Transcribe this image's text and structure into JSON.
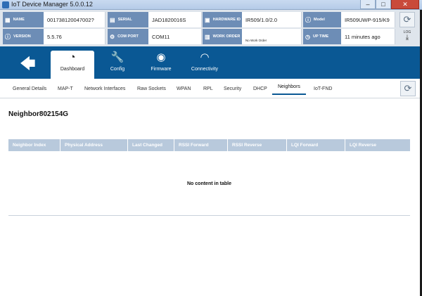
{
  "window": {
    "title": "IoT Device Manager 5.0.0.12",
    "minimize": "–",
    "maximize": "□",
    "close": "✕"
  },
  "info": {
    "row1": [
      {
        "label": "NAME",
        "value": "001738120047002?",
        "icon": "tag-icon"
      },
      {
        "label": "SERIAL",
        "value": "JAD1820016S",
        "icon": "barcode-icon"
      },
      {
        "label": "HARDWARE ID",
        "value": "IR509/1.0/2.0",
        "icon": "chip-icon"
      },
      {
        "label": "Model",
        "value": "IR509UWP-915/K9",
        "icon": "info-icon"
      }
    ],
    "row2": [
      {
        "label": "VERSION",
        "value": "5.5.76",
        "icon": "info-icon"
      },
      {
        "label": "COM PORT",
        "value": "COM11",
        "icon": "port-icon"
      },
      {
        "label": "WORK ORDER",
        "value": "No Work Order",
        "icon": "clipboard-icon"
      },
      {
        "label": "UP TIME",
        "value": "11 minutes ago",
        "icon": "clock-icon"
      }
    ],
    "log_label": "LOG"
  },
  "nav": {
    "items": [
      {
        "label": "Dashboard",
        "icon": "gauge-icon",
        "active": true
      },
      {
        "label": "Config",
        "icon": "wrench-icon"
      },
      {
        "label": "Firmware",
        "icon": "disc-icon"
      },
      {
        "label": "Connectivity",
        "icon": "wifi-icon"
      }
    ]
  },
  "subtabs": [
    "General Details",
    "MAP-T",
    "Network Interfaces",
    "Raw Sockets",
    "WPAN",
    "RPL",
    "Security",
    "DHCP",
    "Neighbors",
    "IoT-FND"
  ],
  "active_subtab": "Neighbors",
  "content": {
    "heading": "Neighbor802154G",
    "columns": [
      "Neighbor Index",
      "Physical Address",
      "Last Changed",
      "RSSI Forward",
      "RSSI Reverse",
      "LQI Forward",
      "LQI Reverse"
    ],
    "empty_message": "No content in table"
  },
  "colors": {
    "primary": "#0a5894",
    "label_bg": "#6d8db6",
    "table_header": "#b8c9dc"
  }
}
